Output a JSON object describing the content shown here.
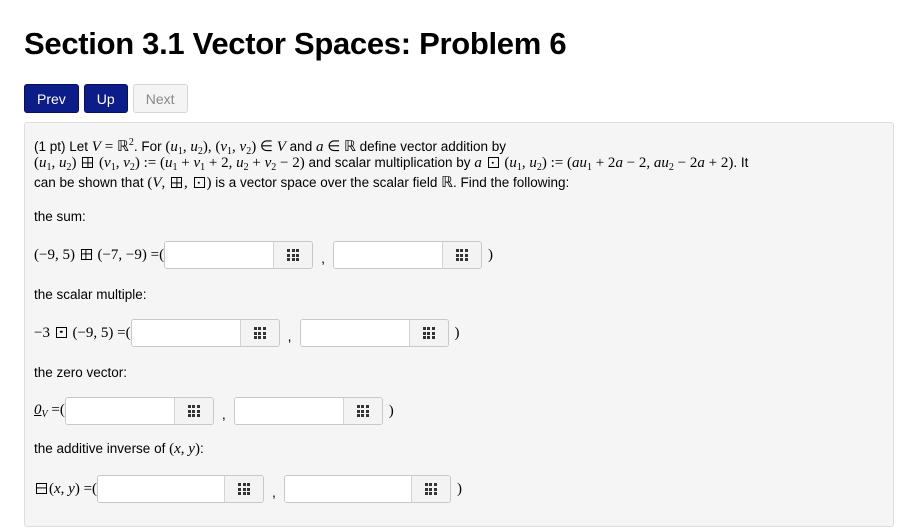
{
  "page_title": "Section 3.1 Vector Spaces: Problem 6",
  "nav": {
    "prev": "Prev",
    "up": "Up",
    "next": "Next"
  },
  "problem": {
    "points": "(1 pt)",
    "sum_label": "the sum:",
    "scalar_label": "the scalar multiple:",
    "zero_label": "the zero vector:",
    "inverse_label": "the additive inverse of",
    "sum_lhs": "(−9, 5) ⊞ (−7, −9) =(",
    "scalar_lhs": "−3 ⊡ (−9, 5) =(",
    "zero_lhs": "0V =(",
    "inverse_lhs": "⊟(x, y) =(",
    "comma": ",",
    "close_paren": ")"
  },
  "answers": {
    "sum": [
      "",
      ""
    ],
    "scalar": [
      "",
      ""
    ],
    "zero": [
      "",
      ""
    ],
    "inverse": [
      "",
      ""
    ]
  }
}
